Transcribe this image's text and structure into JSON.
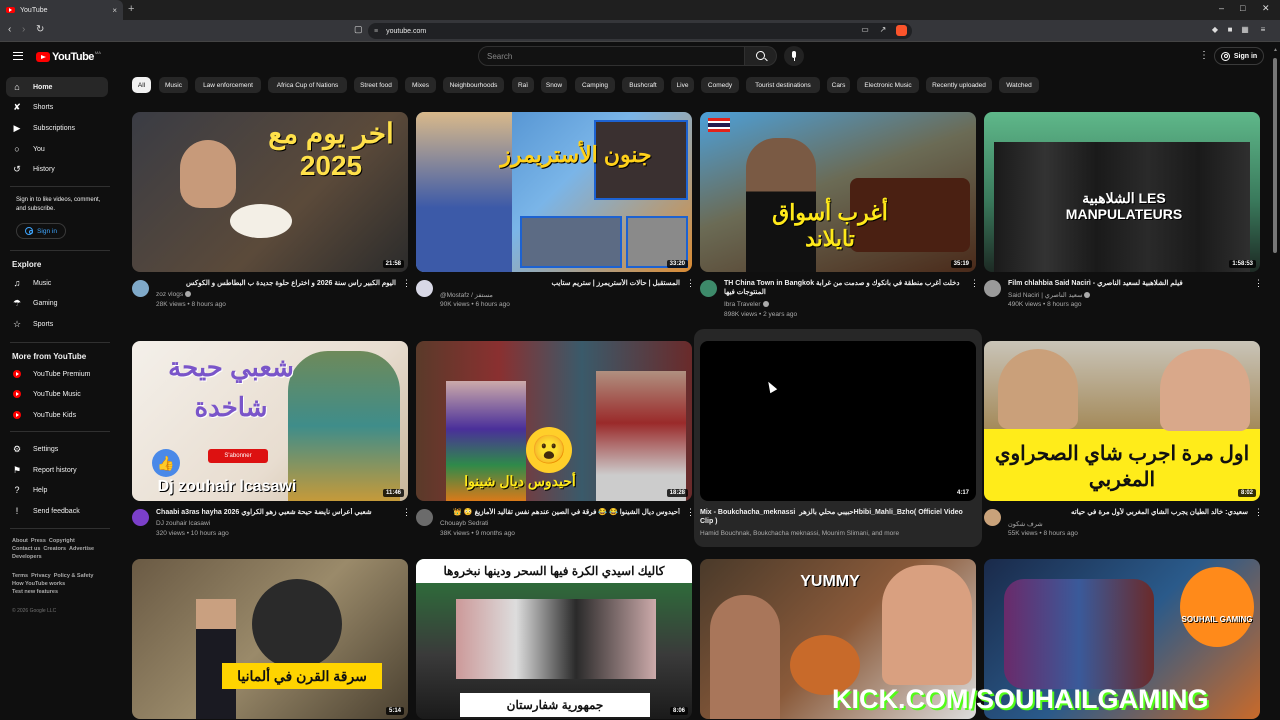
{
  "browser": {
    "tab_title": "YouTube",
    "url": "youtube.com",
    "new_tab": "+",
    "close_tab": "×"
  },
  "header": {
    "logo_text": "YouTube",
    "logo_country": "MA",
    "search_placeholder": "Search",
    "signin_label": "Sign in"
  },
  "sidebar": {
    "main": [
      "Home",
      "Shorts",
      "Subscriptions",
      "You",
      "History"
    ],
    "signin_prompt": "Sign in to like videos, comment, and subscribe.",
    "signin_label": "Sign in",
    "explore_heading": "Explore",
    "explore": [
      "Music",
      "Gaming",
      "Sports"
    ],
    "more_heading": "More from YouTube",
    "more": [
      "YouTube Premium",
      "YouTube Music",
      "YouTube Kids"
    ],
    "settings": [
      "Settings",
      "Report history",
      "Help",
      "Send feedback"
    ],
    "footer_row1": [
      "About",
      "Press",
      "Copyright"
    ],
    "footer_row2": [
      "Contact us",
      "Creators",
      "Advertise"
    ],
    "footer_row3": [
      "Developers"
    ],
    "footer_row4": [
      "Terms",
      "Privacy",
      "Policy & Safety"
    ],
    "footer_row5": [
      "How YouTube works"
    ],
    "footer_row6": [
      "Test new features"
    ],
    "copyright": "© 2026 Google LLC"
  },
  "chips": [
    "All",
    "Music",
    "Law enforcement",
    "Africa Cup of Nations",
    "Street food",
    "Mixes",
    "Neighbourhoods",
    "Raï",
    "Snow",
    "Camping",
    "Bushcraft",
    "Live",
    "Comedy",
    "Tourist destinations",
    "Cars",
    "Electronic Music",
    "Recently uploaded",
    "Watched"
  ],
  "videos": [
    {
      "thumb_text": "اخر يوم مع 2025",
      "duration": "21:58",
      "title": "اليوم الكبير راس سنة 2026 و اختراع حلوة جديدة ب البطاطس و الكوكس",
      "channel": "zoz vlogs",
      "views": "28K views",
      "age": "8 hours ago"
    },
    {
      "thumb_text": "جنون الأستريمرز",
      "duration": "33:20",
      "title": "المستقبل | حالات الأستريمرز | ستريم ستايب",
      "channel": "@Mostafz / مستفز",
      "views": "90K views",
      "age": "6 hours ago"
    },
    {
      "thumb_text": "أغرب أسواق تايلاند",
      "duration": "35:19",
      "title": "TH China Town in Bangkok دخلت أغرب منطقة في بانكوك و صدمت من غرابة المنتوجات فيها",
      "channel": "Ibra Traveler",
      "views": "898K views",
      "age": "2 years ago"
    },
    {
      "thumb_text": "الشلاهبية LES MANPULATEURS",
      "duration": "1:58:53",
      "title": "Film chlahbia Said Nacirì - فيلم الشلاهبية لسعيد الناصري",
      "channel": "Said Naciri | سعيد الناصري",
      "views": "490K views",
      "age": "8 hours ago"
    },
    {
      "thumb_text": "شعبي حيحة شاخدة",
      "thumb_sub": "Dj zouhair lcasawi",
      "thumb_btn": "S'abonner",
      "duration": "11:46",
      "title": "Chaabi a3ras hayha 2026 شعبي أعراس نايضة حيحة شعبي زهو الكراوي",
      "channel": "DJ zouhair lcasawi",
      "views": "320 views",
      "age": "10 hours ago"
    },
    {
      "thumb_text": "أحيدوس ديال شينوا",
      "duration": "18:28",
      "title": "أحيدوس ديال الشينوا 😂 😂 فرقة في الصين عندهم نفس تقاليد الأمازيغ 😳 👑",
      "channel": "Chouayb Sedrati",
      "views": "38K views",
      "age": "9 months ago"
    },
    {
      "thumb_text": "",
      "duration": "4:17",
      "title": "Mix - Boukchacha_meknassi ‏حبيبي محلي بالزهر ‏Hbibi_Mahli_Bzho( Officiel Video Clip )",
      "channel": "Hamid Bouchnak, Boukchacha meknassi, Mounim Slimani, and more",
      "views": "",
      "age": ""
    },
    {
      "thumb_text": "اول مرة اجرب شاي الصحراوي المغربي",
      "duration": "8:02",
      "title": "سعيدي: خالد الطيان يجرب الشاي المغربي لأول مرة في حياته",
      "channel": "شرف شكون",
      "views": "55K views",
      "age": "8 hours ago"
    },
    {
      "thumb_text": "سرقة القرن في ألمانيا",
      "duration": "5:14",
      "title": "",
      "channel": "",
      "views": "",
      "age": ""
    },
    {
      "thumb_text": "كاليك اسيدي الكرة فيها السحر ودينها نبخروها",
      "thumb_sub": "جمهورية شفارستان",
      "duration": "8:06",
      "title": "",
      "channel": "",
      "views": "",
      "age": ""
    },
    {
      "thumb_text": "YUMMY",
      "duration": "",
      "title": "",
      "channel": "",
      "views": "",
      "age": ""
    },
    {
      "thumb_text": "SOUHAIL GAMING",
      "thumb_sub": "KICK.COM/SOUHAILGAMING",
      "duration": "",
      "title": "",
      "channel": "",
      "views": "",
      "age": ""
    }
  ]
}
